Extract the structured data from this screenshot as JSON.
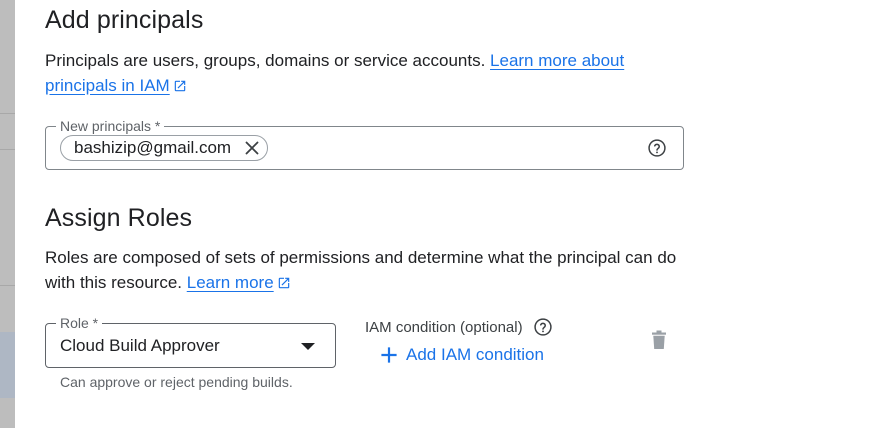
{
  "principals_section": {
    "title": "Add principals",
    "description": "Principals are users, groups, domains or service accounts. ",
    "learn_more_link": "Learn more about principals in IAM",
    "field_label": "New principals *",
    "chips": [
      {
        "label": "bashizip@gmail.com"
      }
    ],
    "help_icon": "help-circle-icon"
  },
  "roles_section": {
    "title": "Assign Roles",
    "description": "Roles are composed of sets of permissions and determine what the principal can do with this resource. ",
    "learn_more_link": "Learn more",
    "role_field_label": "Role *",
    "role_value": "Cloud Build Approver",
    "role_hint": "Can approve or reject pending builds.",
    "condition_label": "IAM condition (optional)",
    "add_condition_label": "Add IAM condition",
    "delete_icon": "trash-icon"
  },
  "colors": {
    "link": "#1a73e8",
    "text": "#202124",
    "muted": "#5f6368",
    "border": "#80868b"
  }
}
